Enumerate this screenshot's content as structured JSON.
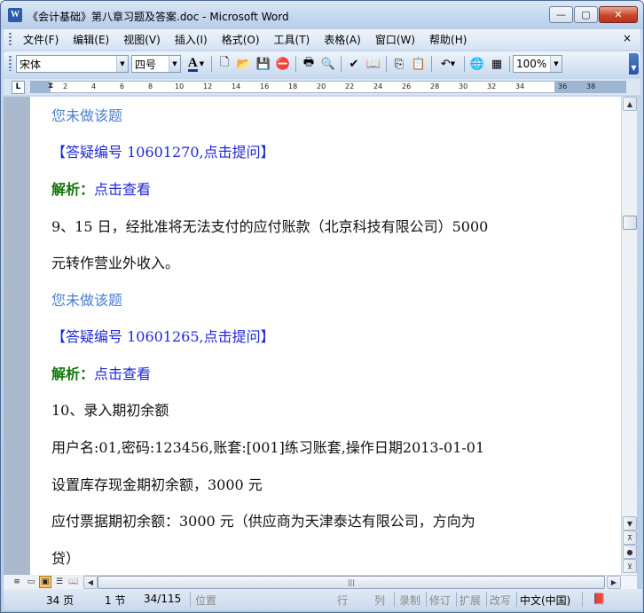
{
  "window": {
    "title": "《会计基础》第八章习题及答案.doc - Microsoft Word",
    "app_icon_letter": "W",
    "controls": {
      "minimize": "—",
      "maximize": "▢",
      "close": "✕"
    }
  },
  "menu": {
    "items": [
      "文件(F)",
      "编辑(E)",
      "视图(V)",
      "插入(I)",
      "格式(O)",
      "工具(T)",
      "表格(A)",
      "窗口(W)",
      "帮助(H)"
    ],
    "close_doc": "×"
  },
  "toolbar": {
    "font_name": "宋体",
    "font_size": "四号",
    "font_color_glyph": "A",
    "zoom": "100%",
    "icons": [
      "new-doc-icon",
      "open-folder-icon",
      "save-icon",
      "permission-icon",
      "print-icon",
      "print-preview-icon",
      "spelling-icon",
      "research-icon",
      "copy-icon",
      "paste-icon",
      "undo-icon",
      "hyperlink-icon",
      "table-icon"
    ],
    "icon_glyphs": {
      "new": "🗋",
      "open": "📂",
      "save": "💾",
      "permission": "⛔",
      "print": "🖶",
      "preview": "🔍",
      "spelling": "✔",
      "research": "📖",
      "copy": "⎘",
      "paste": "📋",
      "undo": "↶",
      "hyperlink": "🌐",
      "table": "▦"
    }
  },
  "ruler": {
    "tab_selector": "L",
    "numbers": [
      "2",
      "4",
      "6",
      "8",
      "10",
      "12",
      "14",
      "16",
      "18",
      "20",
      "22",
      "24",
      "26",
      "28",
      "30",
      "32",
      "34",
      "36",
      "38"
    ]
  },
  "document": {
    "lines": [
      {
        "text": "您未做该题",
        "style": "blue-light"
      },
      {
        "text": "【答疑编号 10601270,点击提问】",
        "style": "blue"
      },
      {
        "label": "解析：",
        "link": "点击查看",
        "style": "green"
      },
      {
        "text": "9、15 日，经批准将无法支付的应付账款（北京科技有限公司）5000",
        "style": "black"
      },
      {
        "text": "元转作营业外收入。",
        "style": "black"
      },
      {
        "text": "您未做该题",
        "style": "blue-light"
      },
      {
        "text": "【答疑编号 10601265,点击提问】",
        "style": "blue"
      },
      {
        "label": "解析：",
        "link": "点击查看",
        "style": "green"
      },
      {
        "text": "10、录入期初余额",
        "style": "black"
      },
      {
        "text": "用户名:01,密码:123456,账套:[001]练习账套,操作日期2013-01-01",
        "style": "black"
      },
      {
        "text": "设置库存现金期初余额，3000 元",
        "style": "black"
      },
      {
        "text": "应付票据期初余额：3000 元（供应商为天津泰达有限公司，方向为",
        "style": "black"
      },
      {
        "text": "贷）",
        "style": "black"
      }
    ]
  },
  "scroll": {
    "up": "▲",
    "down": "▼",
    "prev_page": "⊼",
    "select_browse": "●",
    "next_page": "⊻",
    "left": "◀",
    "right": "▶",
    "thumb_grip": "|||"
  },
  "view_buttons": [
    "≡",
    "▭",
    "▣",
    "☰",
    "📖"
  ],
  "status": {
    "page": "34 页",
    "section": "1 节",
    "page_of": "34/115",
    "position": "位置",
    "line": "行",
    "column": "列",
    "rec": "录制",
    "trk": "修订",
    "ext": "扩展",
    "ovr": "改写",
    "language": "中文(中国)",
    "spell_icon": "📕"
  }
}
